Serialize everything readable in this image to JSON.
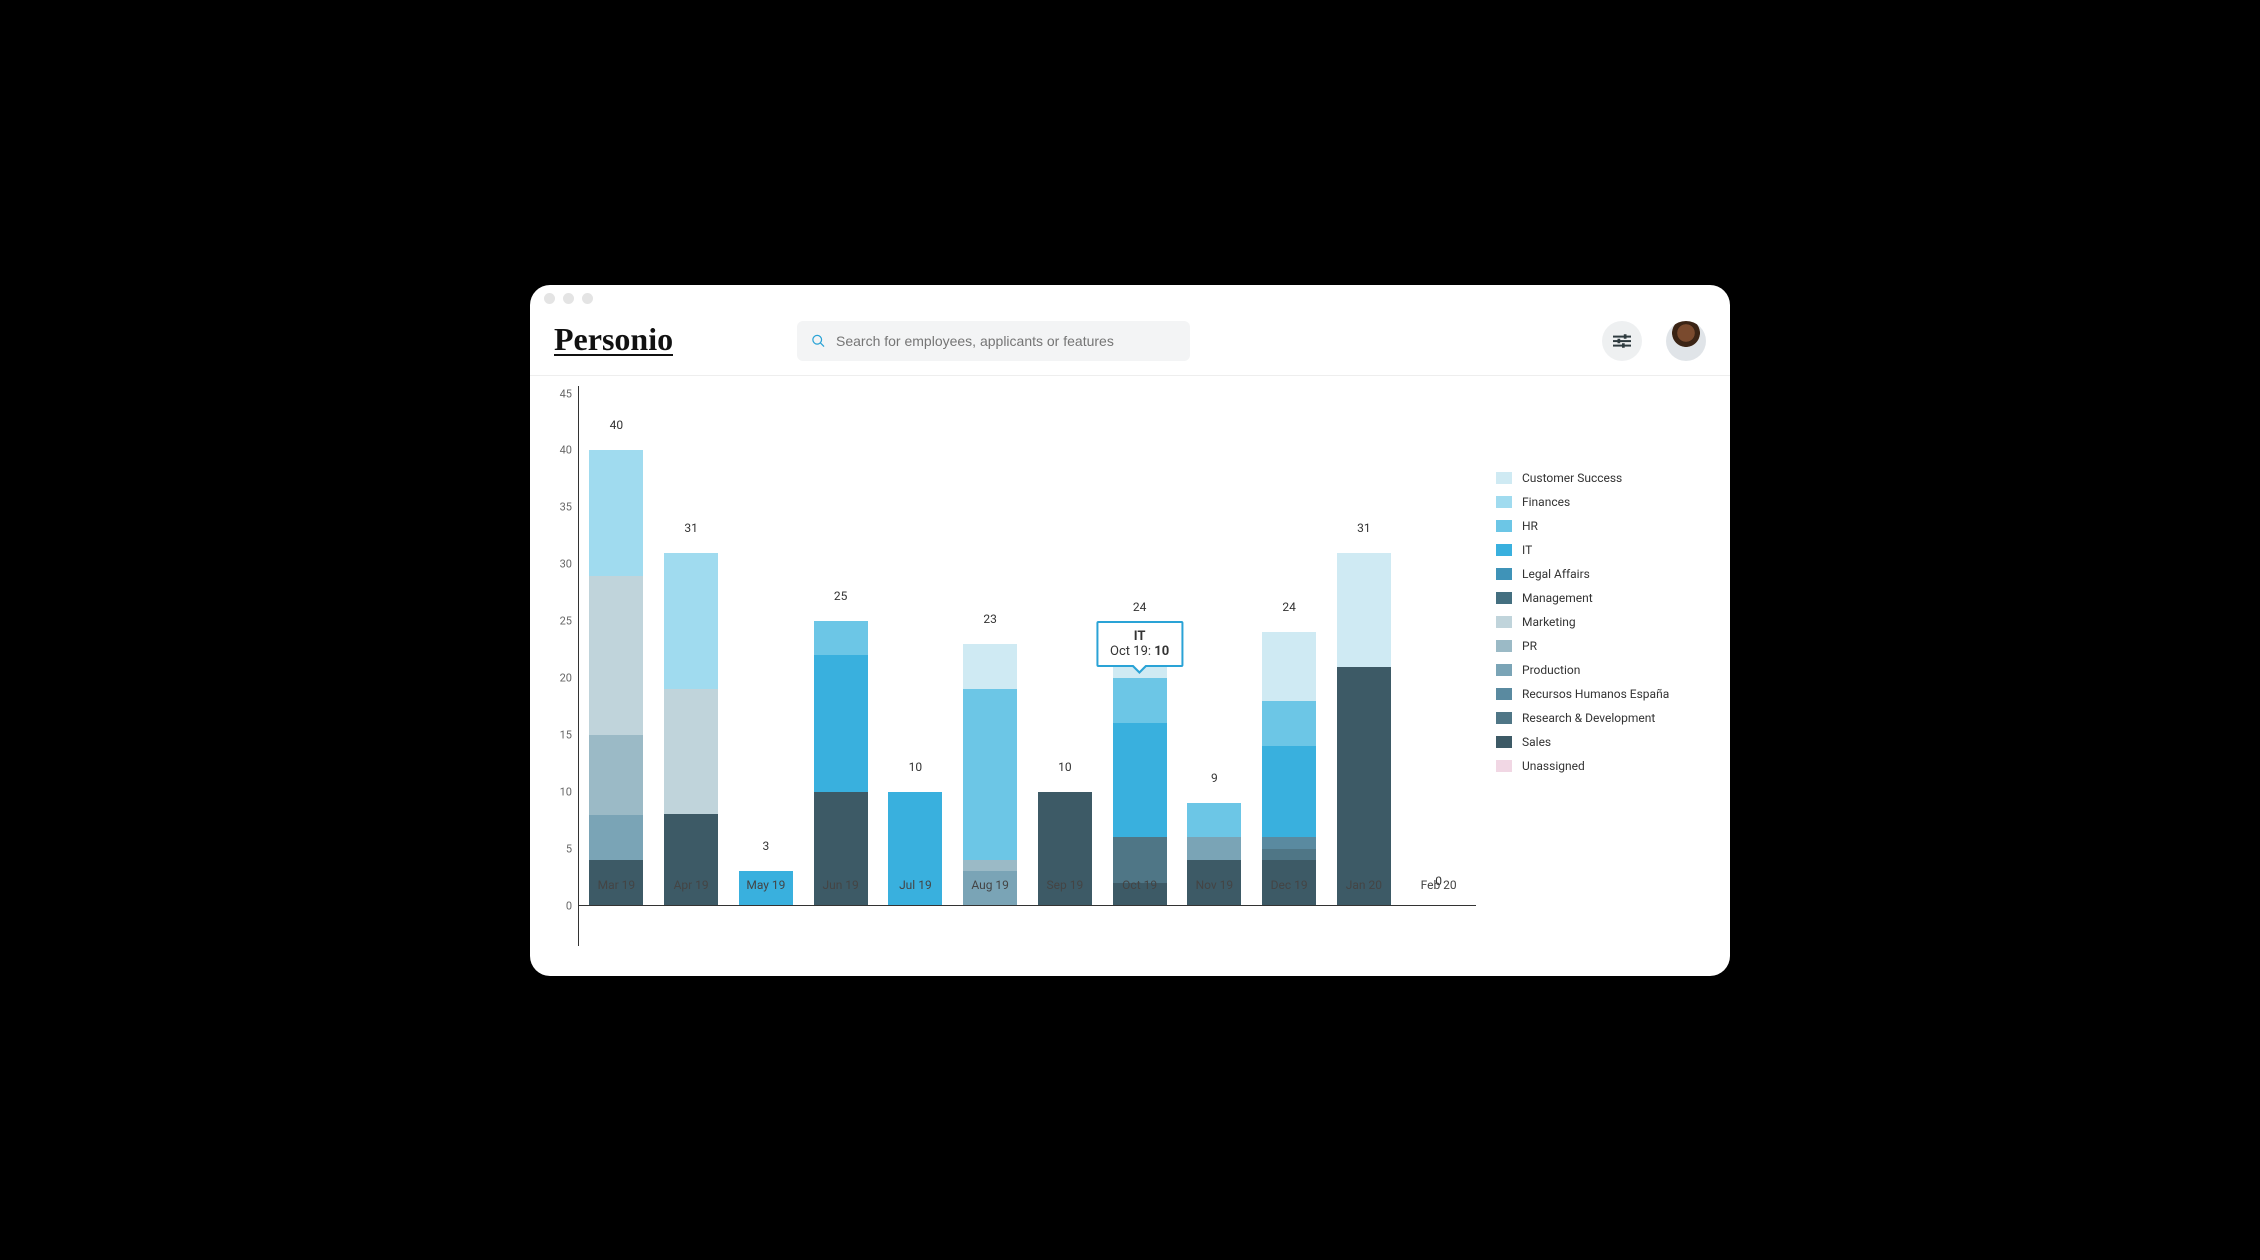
{
  "header": {
    "logo_text": "Personio",
    "search_placeholder": "Search for employees, applicants or features"
  },
  "chart_data": {
    "type": "bar",
    "stacked": true,
    "ylabel": "",
    "xlabel": "",
    "ylim": [
      0,
      45
    ],
    "yticks": [
      0,
      5,
      10,
      15,
      20,
      25,
      30,
      35,
      40,
      45
    ],
    "categories": [
      "Mar 19",
      "Apr 19",
      "May 19",
      "Jun 19",
      "Jul 19",
      "Aug 19",
      "Sep 19",
      "Oct 19",
      "Nov 19",
      "Dec 19",
      "Jan 20",
      "Feb 20"
    ],
    "totals": [
      40,
      31,
      3,
      25,
      10,
      23,
      10,
      24,
      9,
      24,
      31,
      0
    ],
    "series": [
      {
        "name": "Sales",
        "color": "#3d5a66",
        "values": [
          4,
          8,
          0,
          10,
          0,
          0,
          10,
          2,
          4,
          4,
          21,
          0
        ]
      },
      {
        "name": "Research & Development",
        "color": "#4f7686",
        "values": [
          0,
          0,
          0,
          0,
          0,
          0,
          0,
          4,
          0,
          1,
          0,
          0
        ]
      },
      {
        "name": "Recursos Humanos España",
        "color": "#5a8aa0",
        "values": [
          0,
          0,
          0,
          0,
          0,
          0,
          0,
          0,
          0,
          1,
          0,
          0
        ]
      },
      {
        "name": "Production",
        "color": "#7aa4b6",
        "values": [
          4,
          0,
          0,
          0,
          0,
          3,
          0,
          0,
          2,
          0,
          0,
          0
        ]
      },
      {
        "name": "PR",
        "color": "#9bbac6",
        "values": [
          7,
          0,
          0,
          0,
          0,
          1,
          0,
          0,
          0,
          0,
          0,
          0
        ]
      },
      {
        "name": "Marketing",
        "color": "#c0d4db",
        "values": [
          14,
          11,
          0,
          0,
          0,
          0,
          0,
          0,
          0,
          0,
          0,
          0
        ]
      },
      {
        "name": "IT",
        "color": "#39b0de",
        "values": [
          0,
          0,
          3,
          12,
          10,
          0,
          0,
          10,
          0,
          8,
          0,
          0
        ]
      },
      {
        "name": "HR",
        "color": "#6cc6e6",
        "values": [
          0,
          0,
          0,
          3,
          0,
          15,
          0,
          4,
          3,
          4,
          0,
          0
        ]
      },
      {
        "name": "Finances",
        "color": "#a0dbef",
        "values": [
          11,
          12,
          0,
          0,
          0,
          0,
          0,
          0,
          0,
          0,
          0,
          0
        ]
      },
      {
        "name": "Customer Success",
        "color": "#cfeaf3",
        "values": [
          0,
          0,
          0,
          0,
          0,
          4,
          0,
          4,
          0,
          6,
          10,
          0
        ]
      },
      {
        "name": "Management",
        "color": "#446f80",
        "values": [
          0,
          0,
          0,
          0,
          0,
          0,
          0,
          0,
          0,
          0,
          0,
          0
        ]
      },
      {
        "name": "Legal Affairs",
        "color": "#3f93b8",
        "values": [
          0,
          0,
          0,
          0,
          0,
          0,
          0,
          0,
          0,
          0,
          0,
          0
        ]
      },
      {
        "name": "Unassigned",
        "color": "#f1d7e4",
        "values": [
          0,
          0,
          0,
          0,
          0,
          0,
          0,
          0,
          0,
          0,
          0,
          0
        ]
      }
    ],
    "legend_order": [
      "Customer Success",
      "Finances",
      "HR",
      "IT",
      "Legal Affairs",
      "Management",
      "Marketing",
      "PR",
      "Production",
      "Recursos Humanos España",
      "Research & Development",
      "Sales",
      "Unassigned"
    ],
    "tooltip": {
      "category_index": 7,
      "series_name": "IT",
      "category_label": "Oct 19",
      "value": 10
    }
  }
}
